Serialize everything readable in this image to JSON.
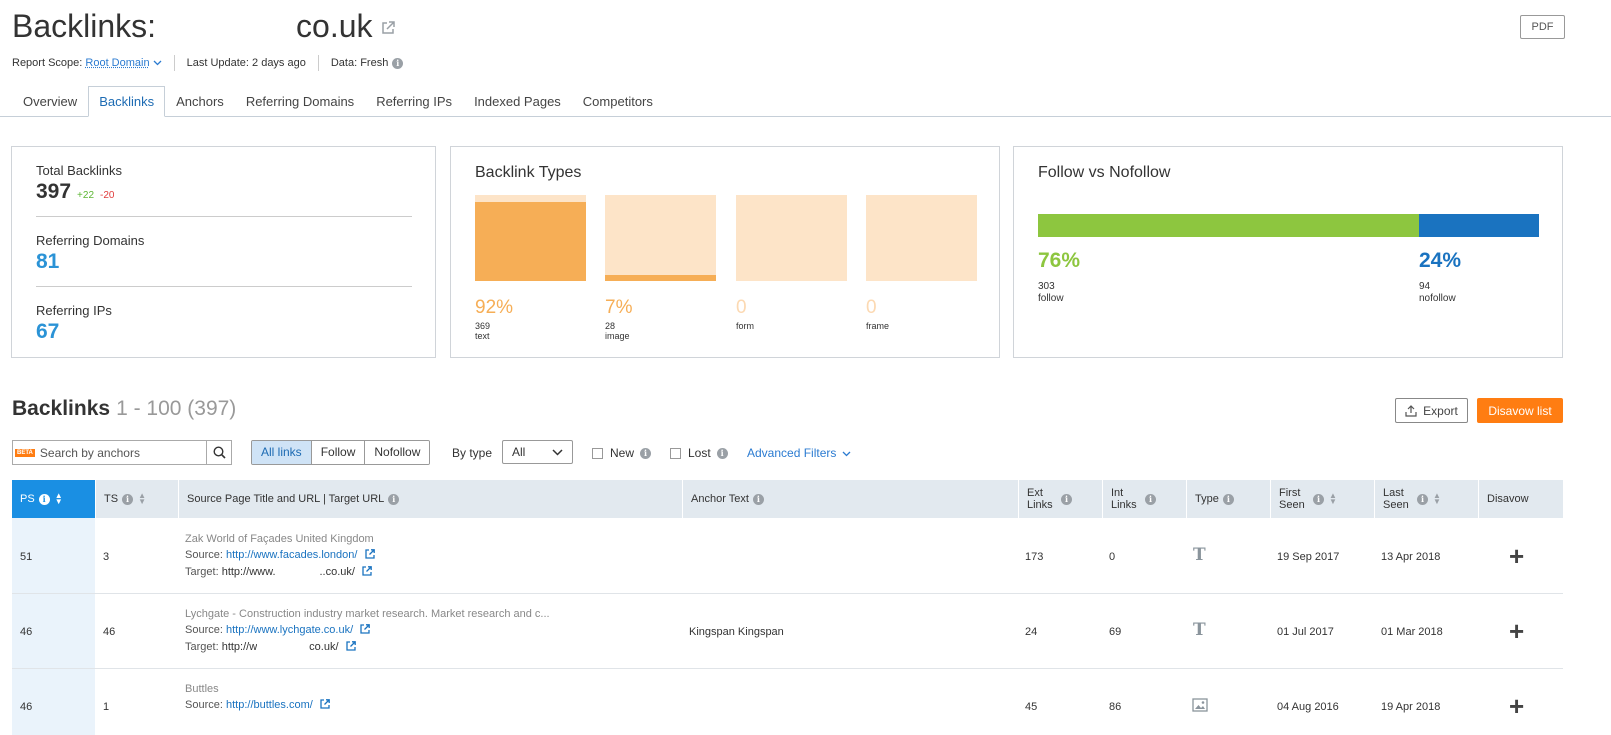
{
  "header": {
    "title_prefix": "Backlinks:",
    "title_domain": "co.uk",
    "pdf_label": "PDF",
    "scope_label": "Report Scope:",
    "scope_value": "Root Domain",
    "last_update": "Last Update: 2 days ago",
    "data_freshness": "Data: Fresh"
  },
  "tabs": [
    "Overview",
    "Backlinks",
    "Anchors",
    "Referring Domains",
    "Referring IPs",
    "Indexed Pages",
    "Competitors"
  ],
  "summary": {
    "total_backlinks_label": "Total Backlinks",
    "total_backlinks": "397",
    "delta_up": "+22",
    "delta_down": "-20",
    "ref_domains_label": "Referring Domains",
    "ref_domains": "81",
    "ref_ips_label": "Referring IPs",
    "ref_ips": "67"
  },
  "backlink_types": {
    "title": "Backlink Types",
    "items": [
      {
        "pct": "92%",
        "count": "369",
        "type": "text",
        "fill": 0.92
      },
      {
        "pct": "7%",
        "count": "28",
        "type": "image",
        "fill": 0.07
      },
      {
        "pct": "0",
        "count": "",
        "type": "form",
        "fill": 0
      },
      {
        "pct": "0",
        "count": "",
        "type": "frame",
        "fill": 0
      }
    ]
  },
  "follow": {
    "title": "Follow vs Nofollow",
    "follow_pct": "76%",
    "follow_count": "303",
    "follow_label": "follow",
    "nofollow_pct": "24%",
    "nofollow_count": "94",
    "nofollow_label": "nofollow",
    "follow_fraction": 0.76,
    "colors": {
      "follow": "#8dc63f",
      "nofollow": "#1a73c0"
    }
  },
  "list": {
    "title": "Backlinks",
    "range": "1 - 100 (397)",
    "export_label": "Export",
    "disavow_list_label": "Disavow list",
    "search_placeholder": "Search by anchors",
    "beta_label": "BETA",
    "filters": [
      "All links",
      "Follow",
      "Nofollow"
    ],
    "by_type_label": "By type",
    "by_type_value": "All",
    "new_label": "New",
    "lost_label": "Lost",
    "advanced_filters_label": "Advanced Filters"
  },
  "table": {
    "columns": {
      "ps": "PS",
      "ts": "TS",
      "source": "Source Page Title and URL | Target URL",
      "anchor": "Anchor Text",
      "ext_links": "Ext Links",
      "int_links": "Int Links",
      "type": "Type",
      "first_seen": "First Seen",
      "last_seen": "Last Seen",
      "disavow": "Disavow"
    },
    "rows": [
      {
        "ps": "51",
        "ts": "3",
        "title": "Zak World of Façades United Kingdom",
        "source_label": "Source:",
        "source_url": "http://www.facades.london/",
        "target_label": "Target:",
        "target_url_start": "http://www.",
        "target_url_end": "..co.uk/",
        "anchor": "",
        "ext": "173",
        "int": "0",
        "type": "text",
        "first_seen": "19 Sep 2017",
        "last_seen": "13 Apr 2018"
      },
      {
        "ps": "46",
        "ts": "46",
        "title": "Lychgate - Construction industry market research. Market research and c...",
        "source_label": "Source:",
        "source_url": "http://www.lychgate.co.uk/",
        "target_label": "Target:",
        "target_url_start": "http://w",
        "target_url_end": "co.uk/",
        "anchor": "Kingspan Kingspan",
        "ext": "24",
        "int": "69",
        "type": "text",
        "first_seen": "01 Jul 2017",
        "last_seen": "01 Mar 2018"
      },
      {
        "ps": "46",
        "ts": "1",
        "title": "Buttles",
        "source_label": "Source:",
        "source_url": "http://buttles.com/",
        "anchor": "",
        "ext": "45",
        "int": "86",
        "type": "image",
        "first_seen": "04 Aug 2016",
        "last_seen": "19 Apr 2018"
      }
    ]
  }
}
